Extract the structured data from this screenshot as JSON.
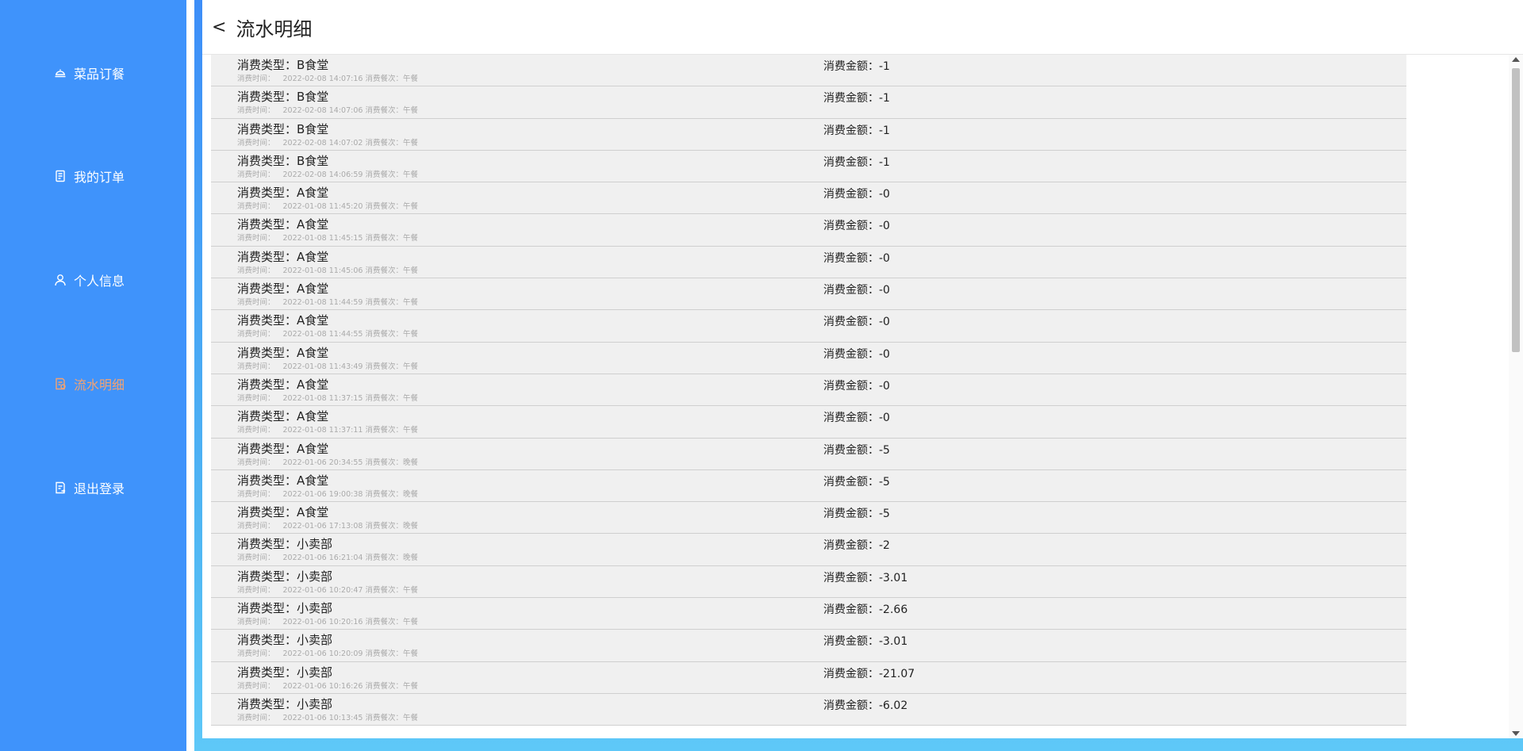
{
  "sidebar": {
    "items": [
      {
        "label": "菜品订餐",
        "icon": "dish-icon"
      },
      {
        "label": "我的订单",
        "icon": "order-icon"
      },
      {
        "label": "个人信息",
        "icon": "user-icon"
      },
      {
        "label": "流水明细",
        "icon": "bill-icon",
        "active": true
      },
      {
        "label": "退出登录",
        "icon": "logout-icon"
      }
    ],
    "active_color": "#f3a272",
    "background": "#3f93fb"
  },
  "header": {
    "back_label": "<",
    "title": "流水明细"
  },
  "labels": {
    "type_prefix": "消费类型：",
    "time_prefix": "消费时间：",
    "meal_prefix": "消费餐次：",
    "amount_prefix": "消费金额："
  },
  "records": [
    {
      "type": "B食堂",
      "time": "2022-02-08 14:07:16",
      "meal": "午餐",
      "amount": "-1"
    },
    {
      "type": "B食堂",
      "time": "2022-02-08 14:07:06",
      "meal": "午餐",
      "amount": "-1"
    },
    {
      "type": "B食堂",
      "time": "2022-02-08 14:07:02",
      "meal": "午餐",
      "amount": "-1"
    },
    {
      "type": "B食堂",
      "time": "2022-02-08 14:06:59",
      "meal": "午餐",
      "amount": "-1"
    },
    {
      "type": "A食堂",
      "time": "2022-01-08 11:45:20",
      "meal": "午餐",
      "amount": "-0"
    },
    {
      "type": "A食堂",
      "time": "2022-01-08 11:45:15",
      "meal": "午餐",
      "amount": "-0"
    },
    {
      "type": "A食堂",
      "time": "2022-01-08 11:45:06",
      "meal": "午餐",
      "amount": "-0"
    },
    {
      "type": "A食堂",
      "time": "2022-01-08 11:44:59",
      "meal": "午餐",
      "amount": "-0"
    },
    {
      "type": "A食堂",
      "time": "2022-01-08 11:44:55",
      "meal": "午餐",
      "amount": "-0"
    },
    {
      "type": "A食堂",
      "time": "2022-01-08 11:43:49",
      "meal": "午餐",
      "amount": "-0"
    },
    {
      "type": "A食堂",
      "time": "2022-01-08 11:37:15",
      "meal": "午餐",
      "amount": "-0"
    },
    {
      "type": "A食堂",
      "time": "2022-01-08 11:37:11",
      "meal": "午餐",
      "amount": "-0"
    },
    {
      "type": "A食堂",
      "time": "2022-01-06 20:34:55",
      "meal": "晚餐",
      "amount": "-5"
    },
    {
      "type": "A食堂",
      "time": "2022-01-06 19:00:38",
      "meal": "晚餐",
      "amount": "-5"
    },
    {
      "type": "A食堂",
      "time": "2022-01-06 17:13:08",
      "meal": "晚餐",
      "amount": "-5"
    },
    {
      "type": "小卖部",
      "time": "2022-01-06 16:21:04",
      "meal": "晚餐",
      "amount": "-2"
    },
    {
      "type": "小卖部",
      "time": "2022-01-06 10:20:47",
      "meal": "午餐",
      "amount": "-3.01"
    },
    {
      "type": "小卖部",
      "time": "2022-01-06 10:20:16",
      "meal": "午餐",
      "amount": "-2.66"
    },
    {
      "type": "小卖部",
      "time": "2022-01-06 10:20:09",
      "meal": "午餐",
      "amount": "-3.01"
    },
    {
      "type": "小卖部",
      "time": "2022-01-06 10:16:26",
      "meal": "午餐",
      "amount": "-21.07"
    },
    {
      "type": "小卖部",
      "time": "2022-01-06 10:13:45",
      "meal": "午餐",
      "amount": "-6.02"
    }
  ]
}
